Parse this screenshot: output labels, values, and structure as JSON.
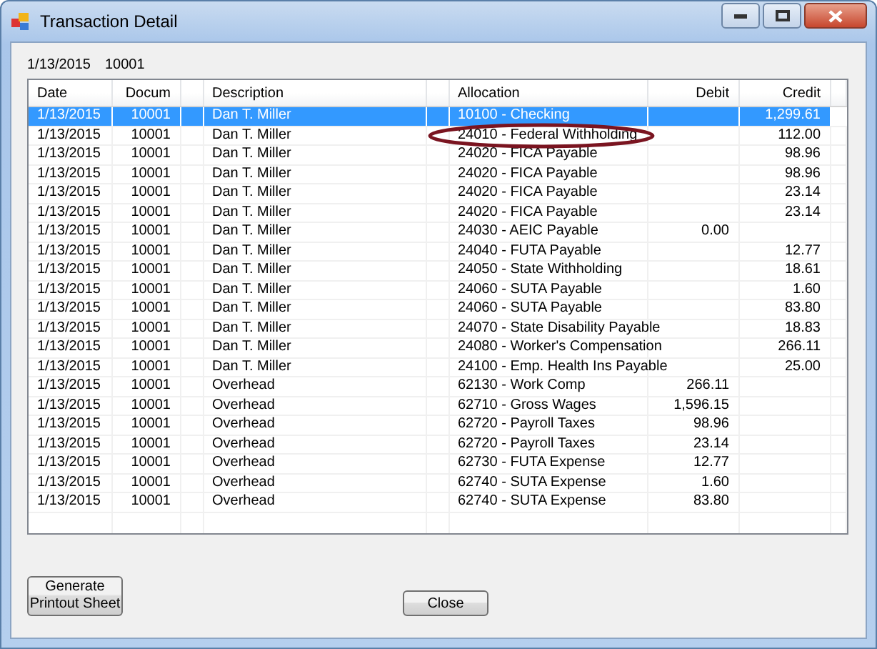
{
  "window": {
    "title": "Transaction Detail"
  },
  "header": {
    "date": "1/13/2015",
    "document": "10001"
  },
  "table": {
    "columns": [
      {
        "kind": "text",
        "label": "Date"
      },
      {
        "kind": "number",
        "label": "Docum"
      },
      {
        "kind": "spacer"
      },
      {
        "kind": "text",
        "label": "Description"
      },
      {
        "kind": "spacer"
      },
      {
        "kind": "text",
        "label": "Allocation"
      },
      {
        "kind": "number",
        "label": "Debit"
      },
      {
        "kind": "number",
        "label": "Credit"
      }
    ],
    "rows": [
      {
        "date": "1/13/2015",
        "docum": "10001",
        "description": "Dan T. Miller",
        "allocation": "10100 - Checking",
        "credit": "1,299.61",
        "selected": true,
        "circled": false
      },
      {
        "date": "1/13/2015",
        "docum": "10001",
        "description": "Dan T. Miller",
        "allocation": "24010 - Federal Withholding",
        "credit": "112.00",
        "selected": false,
        "circled": true
      },
      {
        "date": "1/13/2015",
        "docum": "10001",
        "description": "Dan T. Miller",
        "allocation": "24020 - FICA Payable",
        "credit": "98.96",
        "selected": false,
        "circled": false
      },
      {
        "date": "1/13/2015",
        "docum": "10001",
        "description": "Dan T. Miller",
        "allocation": "24020 - FICA Payable",
        "credit": "98.96",
        "selected": false,
        "circled": false
      },
      {
        "date": "1/13/2015",
        "docum": "10001",
        "description": "Dan T. Miller",
        "allocation": "24020 - FICA Payable",
        "credit": "23.14",
        "selected": false,
        "circled": false
      },
      {
        "date": "1/13/2015",
        "docum": "10001",
        "description": "Dan T. Miller",
        "allocation": "24020 - FICA Payable",
        "credit": "23.14",
        "selected": false,
        "circled": false
      },
      {
        "date": "1/13/2015",
        "docum": "10001",
        "description": "Dan T. Miller",
        "allocation": "24030 - AEIC Payable",
        "debit": "0.00",
        "selected": false,
        "circled": false
      },
      {
        "date": "1/13/2015",
        "docum": "10001",
        "description": "Dan T. Miller",
        "allocation": "24040 - FUTA Payable",
        "credit": "12.77",
        "selected": false,
        "circled": false
      },
      {
        "date": "1/13/2015",
        "docum": "10001",
        "description": "Dan T. Miller",
        "allocation": "24050 - State Withholding",
        "credit": "18.61",
        "selected": false,
        "circled": false
      },
      {
        "date": "1/13/2015",
        "docum": "10001",
        "description": "Dan T. Miller",
        "allocation": "24060 - SUTA Payable",
        "credit": "1.60",
        "selected": false,
        "circled": false
      },
      {
        "date": "1/13/2015",
        "docum": "10001",
        "description": "Dan T. Miller",
        "allocation": "24060 - SUTA Payable",
        "credit": "83.80",
        "selected": false,
        "circled": false
      },
      {
        "date": "1/13/2015",
        "docum": "10001",
        "description": "Dan T. Miller",
        "allocation": "24070 - State Disability Payable",
        "credit": "18.83",
        "selected": false,
        "circled": false
      },
      {
        "date": "1/13/2015",
        "docum": "10001",
        "description": "Dan T. Miller",
        "allocation": "24080 - Worker's Compensation",
        "credit": "266.11",
        "selected": false,
        "circled": false
      },
      {
        "date": "1/13/2015",
        "docum": "10001",
        "description": "Dan T. Miller",
        "allocation": "24100 - Emp. Health Ins Payable",
        "credit": "25.00",
        "selected": false,
        "circled": false
      },
      {
        "date": "1/13/2015",
        "docum": "10001",
        "description": "Overhead",
        "allocation": "62130 - Work Comp",
        "debit": "266.11",
        "selected": false,
        "circled": false
      },
      {
        "date": "1/13/2015",
        "docum": "10001",
        "description": "Overhead",
        "allocation": "62710 - Gross Wages",
        "debit": "1,596.15",
        "selected": false,
        "circled": false
      },
      {
        "date": "1/13/2015",
        "docum": "10001",
        "description": "Overhead",
        "allocation": "62720 - Payroll Taxes",
        "debit": "98.96",
        "selected": false,
        "circled": false
      },
      {
        "date": "1/13/2015",
        "docum": "10001",
        "description": "Overhead",
        "allocation": "62720 - Payroll Taxes",
        "debit": "23.14",
        "selected": false,
        "circled": false
      },
      {
        "date": "1/13/2015",
        "docum": "10001",
        "description": "Overhead",
        "allocation": "62730 - FUTA Expense",
        "debit": "12.77",
        "selected": false,
        "circled": false
      },
      {
        "date": "1/13/2015",
        "docum": "10001",
        "description": "Overhead",
        "allocation": "62740 - SUTA Expense",
        "debit": "1.60",
        "selected": false,
        "circled": false
      },
      {
        "date": "1/13/2015",
        "docum": "10001",
        "description": "Overhead",
        "allocation": "62740 - SUTA Expense",
        "debit": "83.80",
        "selected": false,
        "circled": false
      }
    ]
  },
  "buttons": [
    {
      "kind": "generate",
      "label": "Generate Printout Sheet"
    },
    {
      "kind": "close",
      "label": "Close"
    }
  ]
}
